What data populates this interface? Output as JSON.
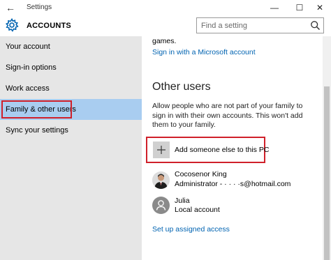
{
  "window": {
    "title": "Settings",
    "back_glyph": "←",
    "controls": {
      "minimize": "—",
      "maximize": "☐",
      "close": "✕"
    }
  },
  "header": {
    "section_title": "ACCOUNTS",
    "search_placeholder": "Find a setting"
  },
  "sidebar": {
    "items": [
      {
        "label": "Your account"
      },
      {
        "label": "Sign-in options"
      },
      {
        "label": "Work access"
      },
      {
        "label": "Family & other users",
        "selected": true
      },
      {
        "label": "Sync your settings"
      }
    ]
  },
  "main": {
    "top_text": "games.",
    "ms_link": "Sign in with a Microsoft account",
    "heading": "Other users",
    "description": "Allow people who are not part of your family to sign in with their own accounts. This won't add them to your family.",
    "add_label": "Add someone else to this PC",
    "users": [
      {
        "name": "Cocosenor King",
        "detail": "Administrator - ·  ·  · ·s@hotmail.com",
        "avatar": "photo"
      },
      {
        "name": "Julia",
        "detail": "Local account",
        "avatar": "person-icon"
      }
    ],
    "assigned_access_link": "Set up assigned access"
  },
  "colors": {
    "accent_link": "#0063b1",
    "selected_nav": "#a9cdf0",
    "sidebar_bg": "#e6e6e6",
    "highlight_box": "#d0202a"
  }
}
